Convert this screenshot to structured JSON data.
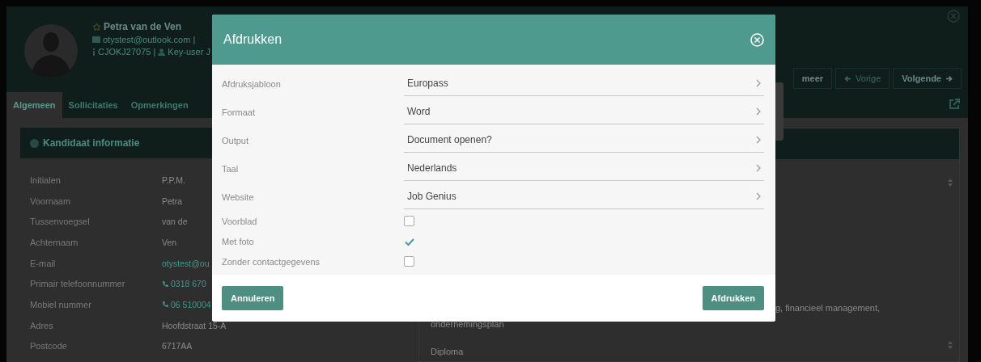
{
  "candidate": {
    "name": "Petra van de Ven",
    "email_line": "otystest@outlook.com |",
    "id_line": "CJOKJ27075 | ",
    "role": "Key-user J"
  },
  "actions": [
    {
      "label": "meer",
      "kind": "more"
    },
    {
      "label": "Vorige",
      "kind": "prev",
      "disabled": true
    },
    {
      "label": "Volgende",
      "kind": "next",
      "disabled": false
    }
  ],
  "tabs": [
    {
      "label": "Algemeen",
      "selected": true
    },
    {
      "label": "Sollicitaties",
      "selected": false
    },
    {
      "label": "Opmerkingen",
      "selected": false
    }
  ],
  "info_card": {
    "title": "Kandidaat informatie",
    "rows": [
      {
        "label": "Initialen",
        "value": "P.P.M."
      },
      {
        "label": "Voornaam",
        "value": "Petra"
      },
      {
        "label": "Tussenvoegsel",
        "value": "van de"
      },
      {
        "label": "Achternaam",
        "value": "Ven"
      },
      {
        "label": "E-mail",
        "value": "otystest@ou",
        "kind": "link"
      },
      {
        "label": "Primair telefoonnummer",
        "value": "0318 670",
        "kind": "phone"
      },
      {
        "label": "Mobiel nummer",
        "value": "06 510004",
        "kind": "phone"
      },
      {
        "label": "Adres",
        "value": "Hoofdstraat 15-A"
      },
      {
        "label": "Postcode",
        "value": "6717AA"
      }
    ]
  },
  "right_card": {
    "text_1": "g, financieel management,",
    "text_2": "ondernemingsplan",
    "text_3": "Diploma"
  },
  "dialog": {
    "title": "Afdrukken",
    "fields": [
      {
        "kind": "select",
        "label": "Afdruksjabloon",
        "value": "Europass"
      },
      {
        "kind": "select",
        "label": "Formaat",
        "value": "Word"
      },
      {
        "kind": "select",
        "label": "Output",
        "value": "Document openen?"
      },
      {
        "kind": "select",
        "label": "Taal",
        "value": "Nederlands"
      },
      {
        "kind": "select",
        "label": "Website",
        "value": "Job Genius"
      },
      {
        "kind": "checkbox",
        "label": "Voorblad",
        "checked": false
      },
      {
        "kind": "checkbox",
        "label": "Met foto",
        "checked": true
      },
      {
        "kind": "checkbox",
        "label": "Zonder contactgegevens",
        "checked": false
      }
    ],
    "cancel": "Annuleren",
    "confirm": "Afdrukken"
  }
}
